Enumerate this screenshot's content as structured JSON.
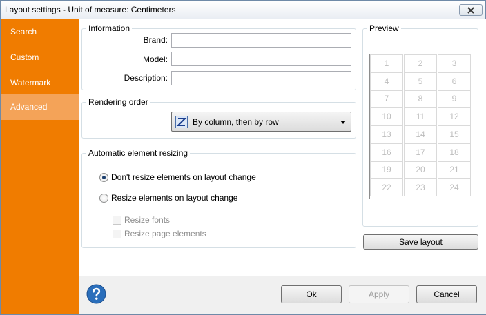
{
  "window": {
    "title": "Layout settings - Unit of measure: Centimeters"
  },
  "sidebar": {
    "items": [
      {
        "label": "Search",
        "active": false
      },
      {
        "label": "Custom",
        "active": false
      },
      {
        "label": "Watermark",
        "active": false
      },
      {
        "label": "Advanced",
        "active": true
      }
    ]
  },
  "information": {
    "legend": "Information",
    "brand_label": "Brand:",
    "brand_value": "",
    "model_label": "Model:",
    "model_value": "",
    "description_label": "Description:",
    "description_value": ""
  },
  "rendering": {
    "legend": "Rendering order",
    "selected": "By column, then by row"
  },
  "resizing": {
    "legend": "Automatic element resizing",
    "option_no_resize": "Don't resize elements on layout change",
    "option_resize": "Resize elements on layout change",
    "resize_fonts": "Resize fonts",
    "resize_page_elements": "Resize page elements",
    "selected_option": "no_resize"
  },
  "preview": {
    "legend": "Preview",
    "cells": [
      "1",
      "2",
      "3",
      "4",
      "5",
      "6",
      "7",
      "8",
      "9",
      "10",
      "11",
      "12",
      "13",
      "14",
      "15",
      "16",
      "17",
      "18",
      "19",
      "20",
      "21",
      "22",
      "23",
      "24"
    ]
  },
  "buttons": {
    "save_layout": "Save layout",
    "ok": "Ok",
    "apply": "Apply",
    "cancel": "Cancel"
  },
  "colors": {
    "sidebar": "#f07c00",
    "sidebar_active": "#f4a358",
    "help": "#2a6ebb"
  },
  "icons": {
    "close": "close-icon",
    "help": "help-icon",
    "order": "z-order-icon",
    "dropdown": "chevron-down-icon"
  }
}
